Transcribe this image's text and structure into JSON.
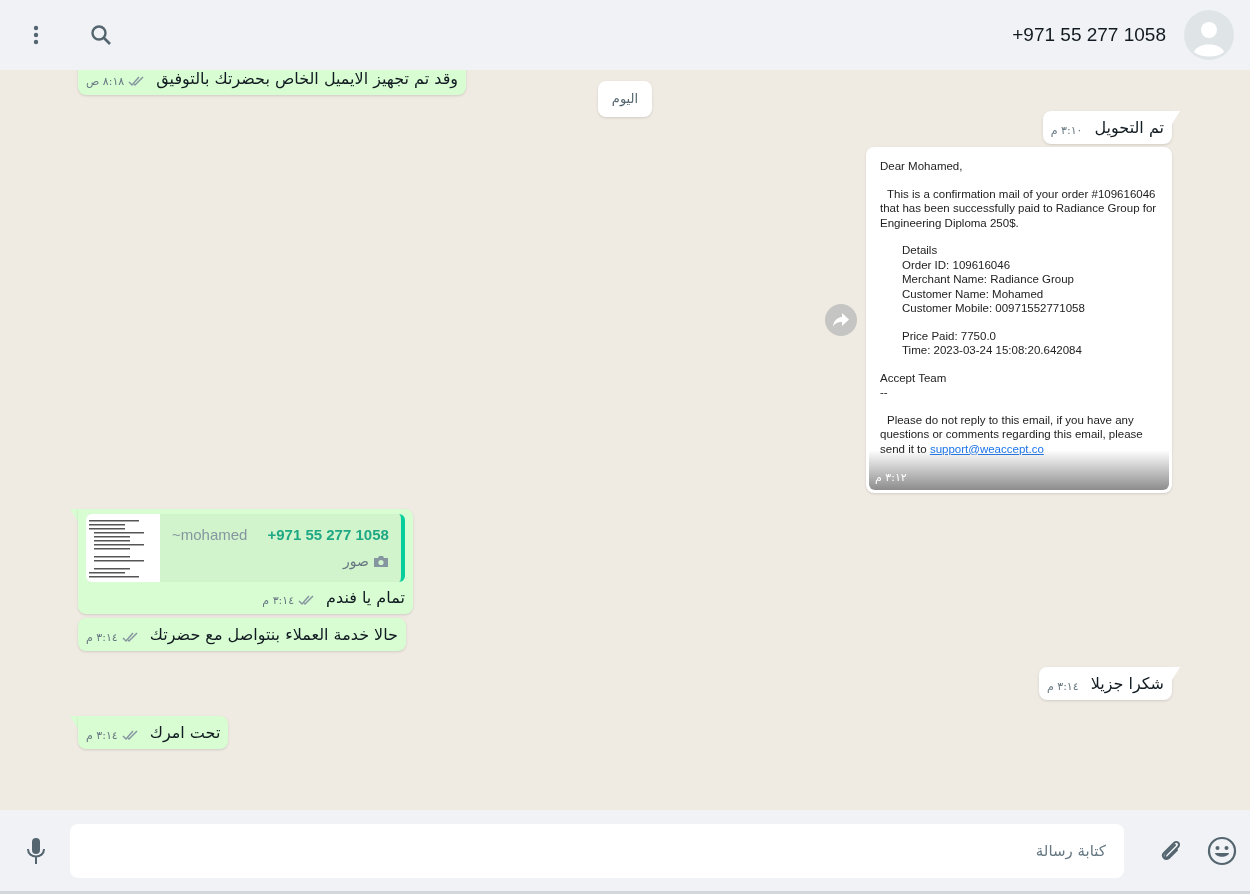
{
  "header": {
    "contact": "+971 55 277 1058"
  },
  "date_pill": "اليوم",
  "messages": [
    {
      "kind": "text",
      "outgoing": true,
      "tail": false,
      "text": "وقد تم تجهيز الايميل الخاص بحضرتك بالتوفيق",
      "time": "٨:١٨ ص"
    },
    {
      "kind": "text",
      "outgoing": false,
      "tail": true,
      "text": "تم التحويل",
      "time": "٣:١٠ م"
    },
    {
      "kind": "email",
      "outgoing": false,
      "time": "٣:١٢ م",
      "blocks": [
        {
          "kind": "plain",
          "lines": [
            "Dear Mohamed,"
          ]
        },
        {
          "kind": "paragraph",
          "lines": [
            "This is a confirmation mail of your order #109616046 that has been successfully paid to Radiance Group for Engineering Diploma 250$."
          ]
        },
        {
          "kind": "indented",
          "lines": [
            "Details",
            "Order ID: 109616046",
            "Merchant Name: Radiance Group",
            "Customer Name: Mohamed",
            "Customer Mobile: 00971552771058"
          ]
        },
        {
          "kind": "indented",
          "lines": [
            "Price Paid: 7750.0",
            "Time: 2023-03-24 15:08:20.642084"
          ]
        },
        {
          "kind": "plain",
          "lines": [
            "Accept Team",
            "--"
          ]
        },
        {
          "kind": "paragraph",
          "lines": [
            "Please do not reply to this email, if you have any questions or comments regarding this email, please send it to"
          ]
        }
      ],
      "link": "support@weaccept.co"
    },
    {
      "kind": "text",
      "outgoing": true,
      "tail": true,
      "text": "تمام يا فندم",
      "time": "٣:١٤ م",
      "quote": {
        "phone": "+971 55 277 1058",
        "name": "~mohamed",
        "media": "صور"
      }
    },
    {
      "kind": "text",
      "outgoing": true,
      "tail": false,
      "text": "حالا خدمة العملاء بنتواصل مع حضرتك",
      "time": "٣:١٤ م"
    },
    {
      "kind": "text",
      "outgoing": false,
      "tail": true,
      "text": "شكرا جزيلا",
      "time": "٣:١٤ م"
    },
    {
      "kind": "text",
      "outgoing": true,
      "tail": true,
      "text": "تحت امرك",
      "time": "٣:١٤ م"
    }
  ],
  "composer": {
    "placeholder": "كتابة رسالة"
  }
}
